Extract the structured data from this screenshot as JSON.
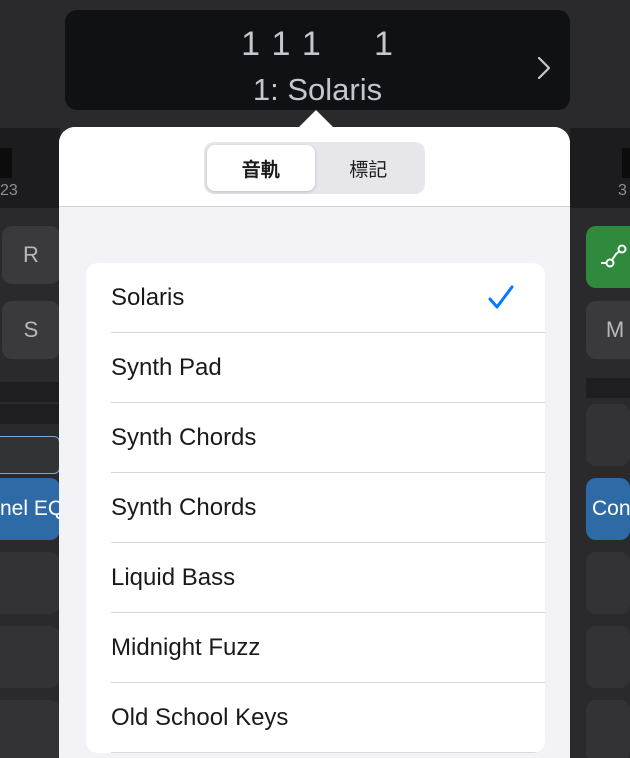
{
  "header": {
    "counter": "1 1 1     1",
    "track_name": "1: Solaris"
  },
  "tabs": [
    {
      "label": "音軌",
      "selected": true
    },
    {
      "label": "標記",
      "selected": false
    }
  ],
  "tracks": [
    {
      "label": "Solaris",
      "checked": true
    },
    {
      "label": "Synth Pad",
      "checked": false
    },
    {
      "label": "Synth Chords",
      "checked": false
    },
    {
      "label": "Synth Chords",
      "checked": false
    },
    {
      "label": "Liquid Bass",
      "checked": false
    },
    {
      "label": "Midnight Fuzz",
      "checked": false
    },
    {
      "label": "Old School Keys",
      "checked": false
    }
  ],
  "background": {
    "ruler_left": "23",
    "ruler_right": "3",
    "left_buttons": [
      "R",
      "S"
    ],
    "left_plugin": "nel EQ",
    "right_button": "M",
    "right_plugin": "Con"
  },
  "colors": {
    "accent": "#007aff",
    "plugin_blue": "#2e6aa6",
    "automation_green": "#2f8a3d"
  }
}
